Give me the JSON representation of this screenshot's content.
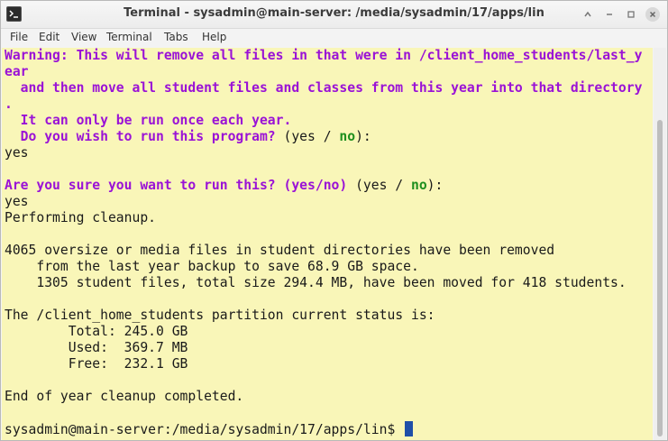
{
  "window": {
    "title": "Terminal - sysadmin@main-server: /media/sysadmin/17/apps/lin",
    "controls": [
      "chevron-up-icon",
      "minimize-icon",
      "maximize-icon",
      "close-icon"
    ]
  },
  "menubar": {
    "items": [
      "File",
      "Edit",
      "View",
      "Terminal",
      "Tabs",
      "Help"
    ]
  },
  "terminal": {
    "warning_1": "Warning: This will remove all files in that were in /client_home_students/last_y",
    "warning_2": "ear",
    "warning_3": "  and then move all student files and classes from this year into that directory",
    "warning_4": ".",
    "warning_5": "  It can only be run once each year.",
    "prompt1_question": "  Do you wish to run this program?",
    "prompt1_open": " (yes / ",
    "prompt1_no": "no",
    "prompt1_close": "):",
    "answer1": "yes",
    "prompt2_question": "Are you sure you want to run this? (yes/no)",
    "prompt2_open": " (yes / ",
    "prompt2_no": "no",
    "prompt2_close": "):",
    "answer2": "yes",
    "performing": "Performing cleanup.",
    "removed_1": "4065 oversize or media files in student directories have been removed",
    "removed_2": "    from the last year backup to save 68.9 GB space.",
    "moved": "    1305 student files, total size 294.4 MB, have been moved for 418 students.",
    "partition_header": "The /client_home_students partition current status is:",
    "total": "        Total: 245.0 GB",
    "used": "        Used:  369.7 MB",
    "free": "        Free:  232.1 GB",
    "completed": "End of year cleanup completed.",
    "prompt": "sysadmin@main-server:/media/sysadmin/17/apps/lin$ "
  },
  "colors": {
    "terminal_bg": "#f9f6b8",
    "warning_text": "#9a12d6",
    "default_answer": "#1e8f1e",
    "cursor": "#1f4fa8"
  }
}
